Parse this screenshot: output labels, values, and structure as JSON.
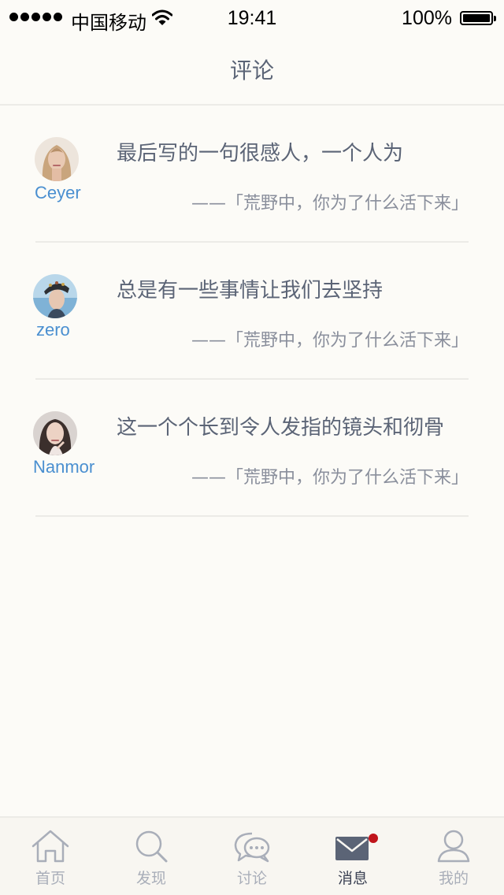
{
  "status_bar": {
    "carrier": "中国移动",
    "time": "19:41",
    "battery": "100%"
  },
  "nav": {
    "title": "评论"
  },
  "comments": [
    {
      "user": "Ceyer",
      "text": "最后写的一句很感人，一个人为",
      "quote": "——「荒野中，你为了什么活下来」"
    },
    {
      "user": "zero",
      "text": "总是有一些事情让我们去坚持",
      "quote": "——「荒野中，你为了什么活下来」"
    },
    {
      "user": "Nanmor",
      "text": "这一个个长到令人发指的镜头和彻骨",
      "quote": "——「荒野中，你为了什么活下来」"
    }
  ],
  "tabs": [
    {
      "label": "首页",
      "icon": "home-icon",
      "active": false
    },
    {
      "label": "发现",
      "icon": "search-icon",
      "active": false
    },
    {
      "label": "讨论",
      "icon": "chat-bubbles-icon",
      "active": false
    },
    {
      "label": "消息",
      "icon": "envelope-icon",
      "active": true,
      "badge": true
    },
    {
      "label": "我的",
      "icon": "user-icon",
      "active": false
    }
  ],
  "colors": {
    "background": "#fcfbf7",
    "username": "#4a8fd0",
    "text": "#5b6476",
    "tab_inactive": "#a9aeb9",
    "tab_active": "#3c4254",
    "badge": "#c0141b"
  }
}
